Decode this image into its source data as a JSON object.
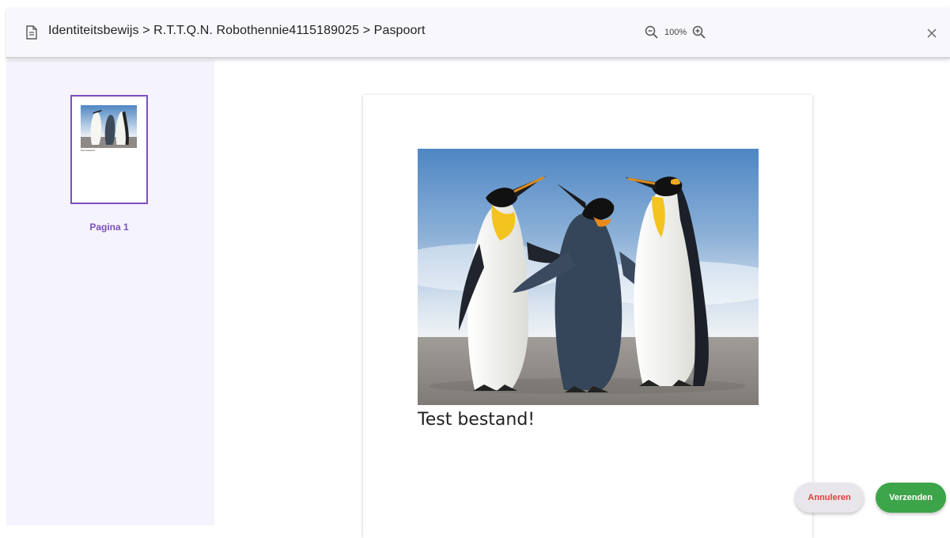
{
  "header": {
    "breadcrumb": "Identiteitsbewijs > R.T.T.Q.N. Robothennie4115189025 > Paspoort",
    "zoom_level": "100%",
    "icons": [
      "document-icon",
      "zoom-out-icon",
      "zoom-in-icon",
      "close-icon"
    ]
  },
  "sidebar": {
    "pages": [
      {
        "label": "Pagina 1",
        "caption": "Test bestand!"
      }
    ]
  },
  "document": {
    "caption": "Test bestand!",
    "image": "penguins-photo"
  },
  "actions": {
    "cancel_label": "Annuleren",
    "send_label": "Verzenden"
  },
  "colors": {
    "accent": "#7b4fbf",
    "cancel_text": "#d9433a",
    "send_bg": "#3ca449",
    "sidebar_bg": "#f5f3fd"
  }
}
